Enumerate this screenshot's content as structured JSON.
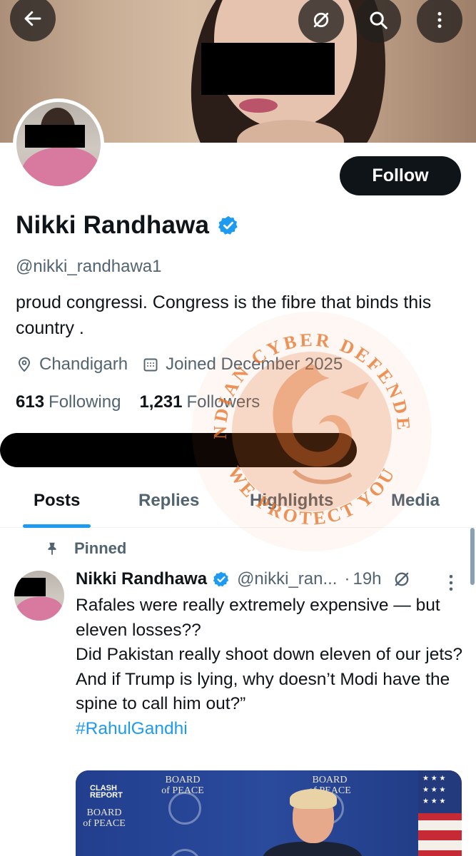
{
  "profile": {
    "display_name": "Nikki Randhawa",
    "handle": "@nikki_randhawa1",
    "bio": "proud congressi. Congress is the fibre that binds this country .",
    "location": "Chandigarh",
    "joined": "Joined December 2025",
    "following_count": "613",
    "following_label": "Following",
    "followers_count": "1,231",
    "followers_label": "Followers",
    "follow_button": "Follow",
    "verified": true
  },
  "top_icons": [
    "back-arrow-icon",
    "grok-icon",
    "search-icon",
    "more-vertical-icon"
  ],
  "tabs": [
    {
      "label": "Posts",
      "active": true
    },
    {
      "label": "Replies",
      "active": false
    },
    {
      "label": "Highlights",
      "active": false
    },
    {
      "label": "Media",
      "active": false
    }
  ],
  "watermark": {
    "top_text": "INDIAN CYBER DEFENDER",
    "bottom_text": "WE PROTECT YOU"
  },
  "pinned_post": {
    "pinned_label": "Pinned",
    "author_name": "Nikki Randhawa",
    "author_handle": "@nikki_ran...",
    "separator": "·",
    "time": "19h",
    "text_lines": [
      "Rafales were really extremely expensive — but eleven losses??",
      "Did Pakistan really shoot down eleven of our jets?",
      "And if Trump is lying, why doesn’t Modi have the spine to call him out?”"
    ],
    "hashtag": "#RahulGandhi",
    "media": {
      "logo_line1": "CLASH",
      "logo_line2": "REPORT",
      "backdrop_text": "BOARD of PEACE"
    }
  },
  "colors": {
    "accent": "#1d9bf0",
    "text_primary": "#0f1419",
    "text_secondary": "#536471",
    "button_bg": "#0f1419",
    "watermark_orange": "#e8742a"
  }
}
